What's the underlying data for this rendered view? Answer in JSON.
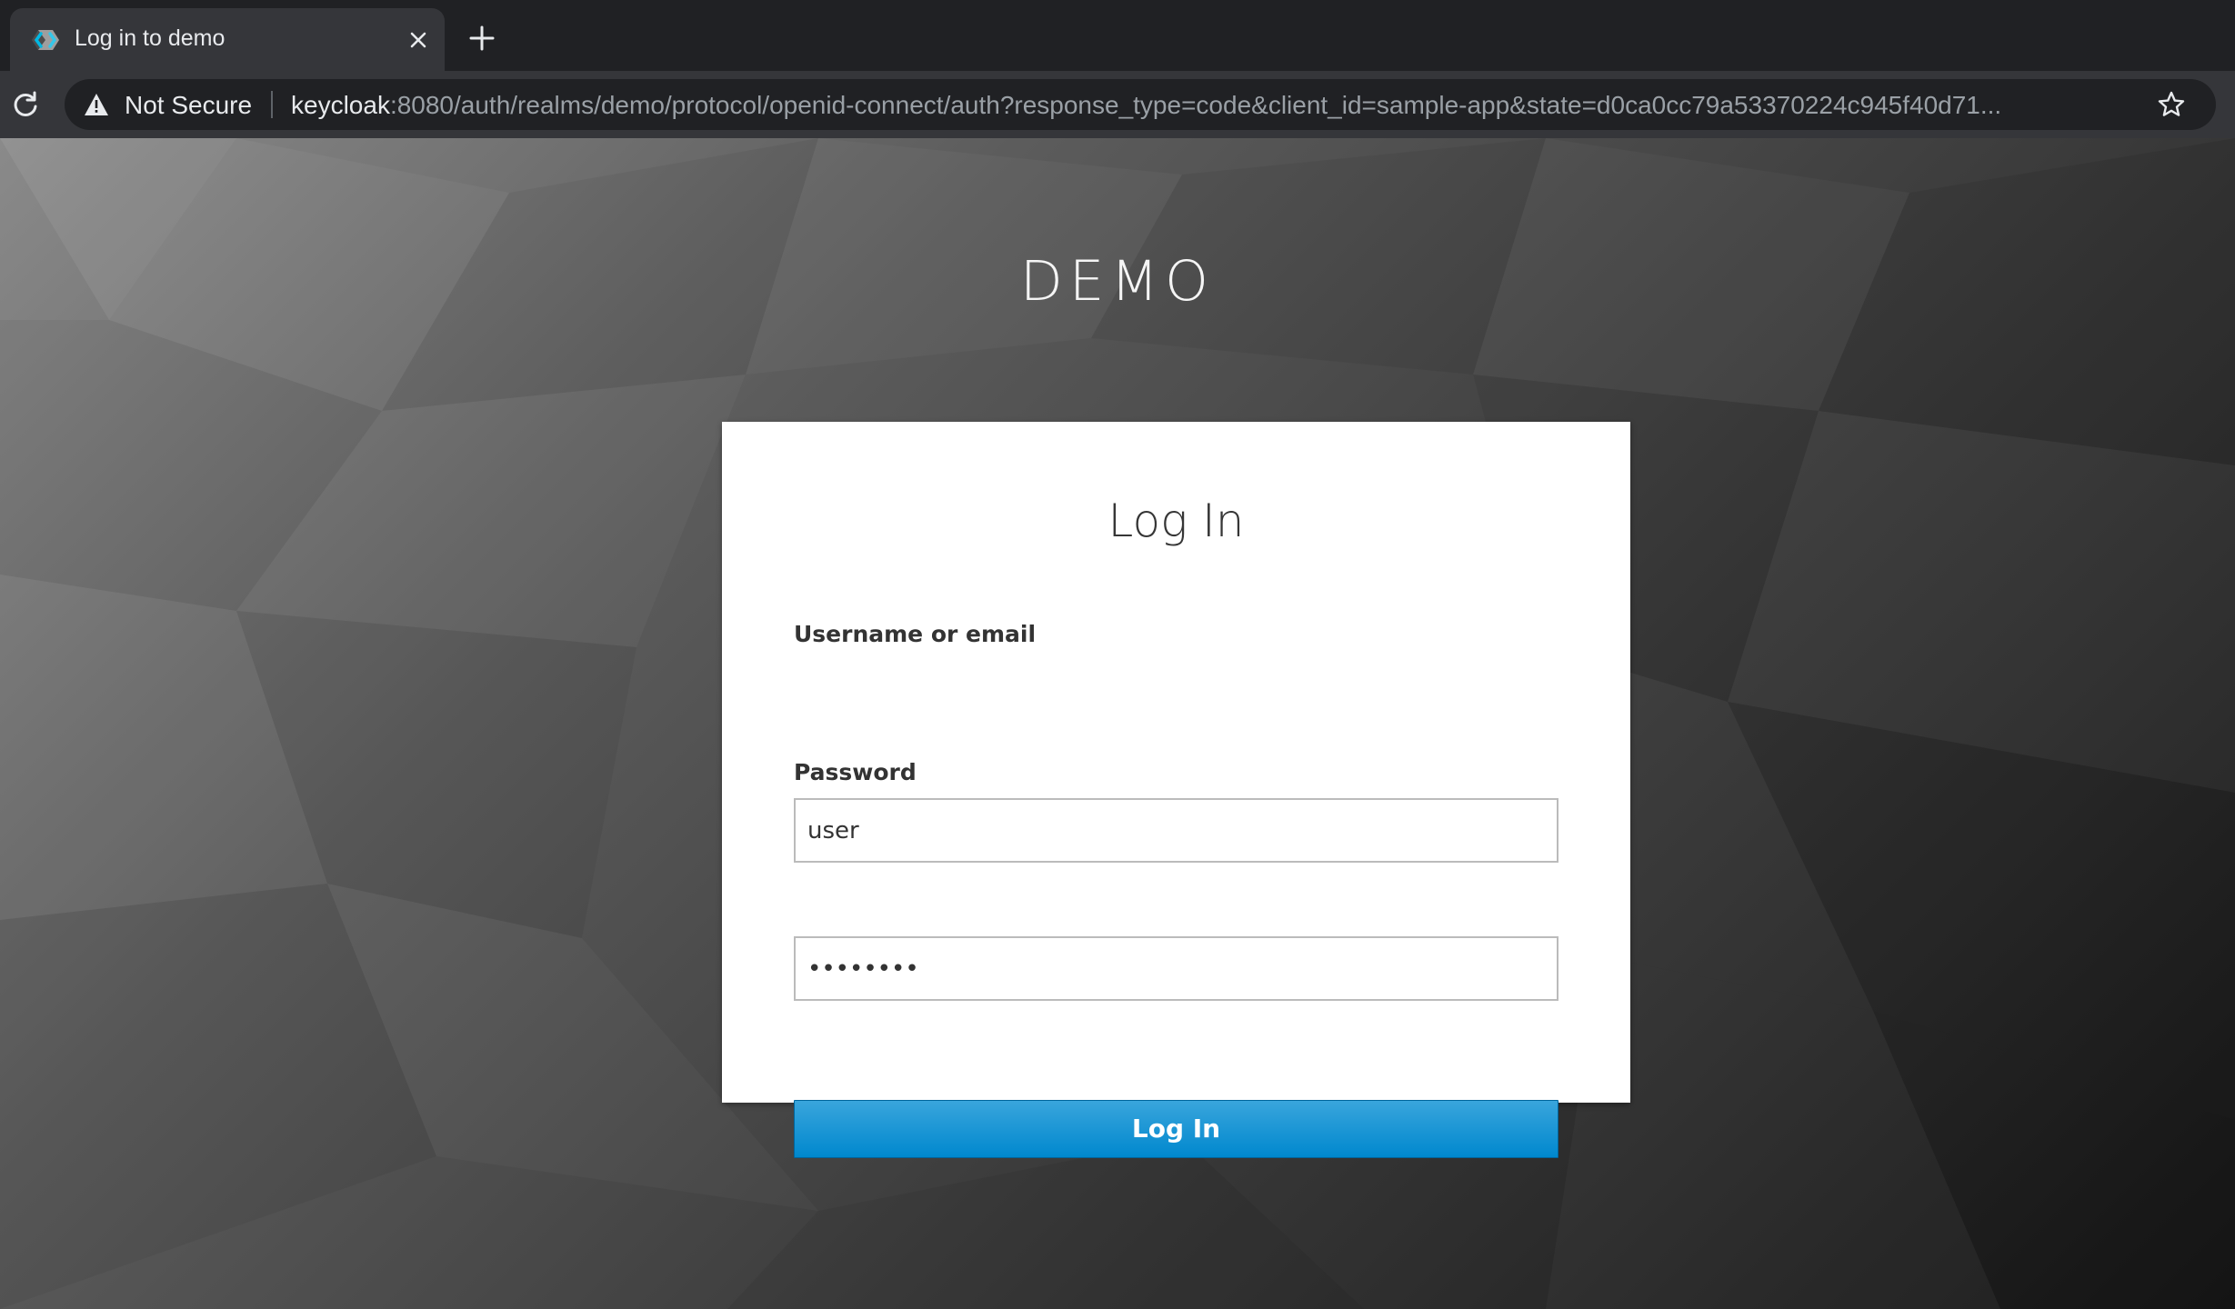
{
  "browser": {
    "tab": {
      "title": "Log in to demo",
      "favicon": "keycloak-favicon-icon",
      "close_icon": "close-icon"
    },
    "new_tab_icon": "plus-icon",
    "reload_icon": "reload-icon",
    "omnibox": {
      "security_icon": "warning-triangle-icon",
      "security_label": "Not Secure",
      "url_host": "keycloak",
      "url_rest": ":8080/auth/realms/demo/protocol/openid-connect/auth?response_type=code&client_id=sample-app&state=d0ca0cc79a53370224c945f40d71...",
      "bookmark_icon": "star-icon"
    }
  },
  "page": {
    "realm_name": "DEMO",
    "form": {
      "title": "Log In",
      "username_label": "Username or email",
      "username_value": "user",
      "password_label": "Password",
      "password_value": "••••••••",
      "submit_label": "Log In"
    }
  },
  "colors": {
    "chrome_dark": "#202124",
    "chrome_toolbar": "#35363a",
    "button_primary": "#0088ce",
    "card_background": "#ffffff"
  }
}
